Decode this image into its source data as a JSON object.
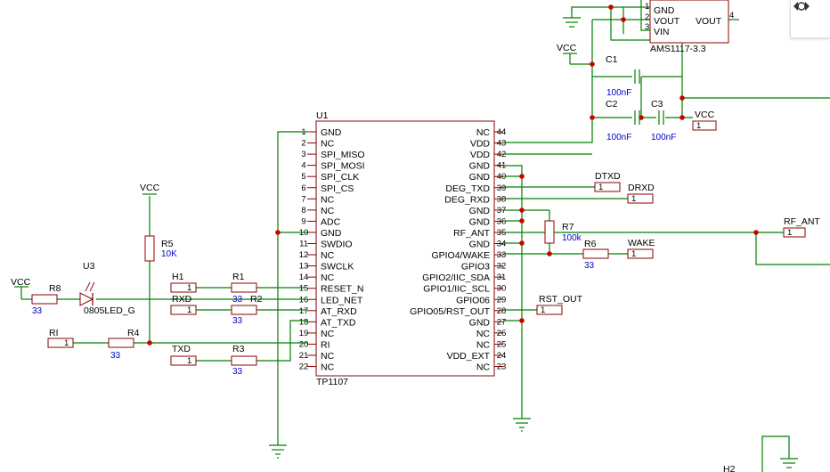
{
  "u1": {
    "ref": "U1",
    "value": "TP1107",
    "left_pins": [
      {
        "num": "1",
        "name": "GND"
      },
      {
        "num": "2",
        "name": "NC"
      },
      {
        "num": "3",
        "name": "SPI_MISO"
      },
      {
        "num": "4",
        "name": "SPI_MOSI"
      },
      {
        "num": "5",
        "name": "SPI_CLK"
      },
      {
        "num": "6",
        "name": "SPI_CS"
      },
      {
        "num": "7",
        "name": "NC"
      },
      {
        "num": "8",
        "name": "NC"
      },
      {
        "num": "9",
        "name": "ADC"
      },
      {
        "num": "10",
        "name": "GND"
      },
      {
        "num": "11",
        "name": "SWDIO"
      },
      {
        "num": "12",
        "name": "NC"
      },
      {
        "num": "13",
        "name": "SWCLK"
      },
      {
        "num": "14",
        "name": "NC"
      },
      {
        "num": "15",
        "name": "RESET_N"
      },
      {
        "num": "16",
        "name": "LED_NET"
      },
      {
        "num": "17",
        "name": "AT_RXD"
      },
      {
        "num": "18",
        "name": "AT_TXD"
      },
      {
        "num": "19",
        "name": "NC"
      },
      {
        "num": "20",
        "name": "RI"
      },
      {
        "num": "21",
        "name": "NC"
      },
      {
        "num": "22",
        "name": "NC"
      }
    ],
    "right_pins": [
      {
        "num": "44",
        "name": "NC"
      },
      {
        "num": "43",
        "name": "VDD"
      },
      {
        "num": "42",
        "name": "VDD"
      },
      {
        "num": "41",
        "name": "GND"
      },
      {
        "num": "40",
        "name": "GND"
      },
      {
        "num": "39",
        "name": "DEG_TXD"
      },
      {
        "num": "38",
        "name": "DEG_RXD"
      },
      {
        "num": "37",
        "name": "GND"
      },
      {
        "num": "36",
        "name": "GND"
      },
      {
        "num": "35",
        "name": "RF_ANT"
      },
      {
        "num": "34",
        "name": "GND"
      },
      {
        "num": "33",
        "name": "GPIO4/WAKE"
      },
      {
        "num": "32",
        "name": "GPIO3"
      },
      {
        "num": "31",
        "name": "GPIO2/IIC_SDA"
      },
      {
        "num": "30",
        "name": "GPIO1/IIC_SCL"
      },
      {
        "num": "29",
        "name": "GPIO06"
      },
      {
        "num": "28",
        "name": "GPIO05/RST_OUT"
      },
      {
        "num": "27",
        "name": "GND"
      },
      {
        "num": "26",
        "name": "NC"
      },
      {
        "num": "25",
        "name": "NC"
      },
      {
        "num": "24",
        "name": "VDD_EXT"
      },
      {
        "num": "23",
        "name": "NC"
      }
    ]
  },
  "regulator": {
    "value": "AMS1117-3.3",
    "pins": [
      {
        "num": "1",
        "name": "GND"
      },
      {
        "num": "2",
        "name": "VOUT"
      },
      {
        "num": "3",
        "name": "VIN"
      },
      {
        "num": "4",
        "name": "VOUT"
      }
    ]
  },
  "passives": {
    "c1": {
      "ref": "C1",
      "value": "100nF"
    },
    "c2": {
      "ref": "C2",
      "value": "100nF"
    },
    "c3": {
      "ref": "C3",
      "value": "100nF"
    },
    "r1": {
      "ref": "R1",
      "value": "33"
    },
    "r2": {
      "ref": "R2",
      "value": "33"
    },
    "r3": {
      "ref": "R3",
      "value": "33"
    },
    "r4": {
      "ref": "R4",
      "value": "33"
    },
    "r5": {
      "ref": "R5",
      "value": "10K"
    },
    "r6": {
      "ref": "R6",
      "value": "33"
    },
    "r7": {
      "ref": "R7",
      "value": "100k"
    },
    "r8": {
      "ref": "R8",
      "value": "33"
    },
    "u3": {
      "ref": "U3",
      "value": "0805LED_G"
    }
  },
  "headers": {
    "h1": "H1",
    "rxd": "RXD",
    "txd": "TXD",
    "ri": "RI",
    "dtxd": "DTXD",
    "drxd": "DRXD",
    "wake": "WAKE",
    "rst_out": "RST_OUT",
    "rf_ant": "RF_ANT",
    "vcc_hdr": "VCC",
    "h2": "H2",
    "pin": "1"
  },
  "power": {
    "vcc": "VCC"
  },
  "toolbar": {
    "icon": "diamond-circle-icon"
  }
}
